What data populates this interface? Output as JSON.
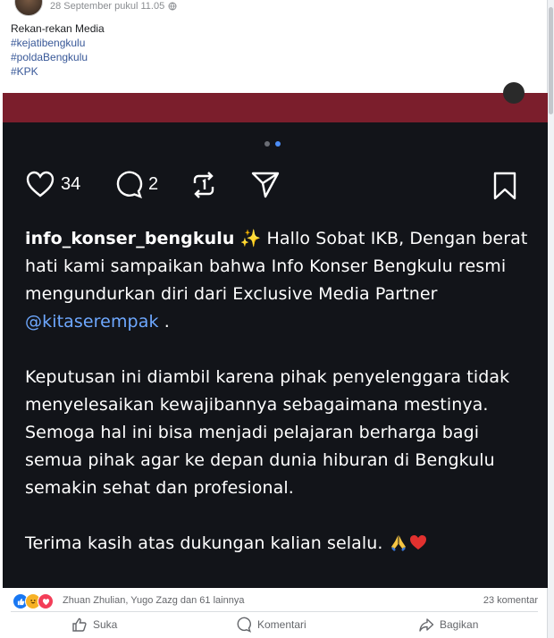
{
  "post": {
    "timestamp": "28 September pukul 11.05",
    "text_line": "Rekan-rekan Media",
    "hashtags": [
      "#kejatibengkulu",
      "#poldaBengkulu",
      "#KPK"
    ]
  },
  "instagram": {
    "likes": "34",
    "comments": "2",
    "caption": {
      "username": "info_konser_bengkulu",
      "sparkle": "✨",
      "intro": " Hallo Sobat IKB, Dengan berat hati kami sampaikan bahwa Info Konser Bengkulu resmi mengundurkan diri dari Exclusive Media Partner ",
      "mention": "@kitaserempak",
      "intro_end": " .",
      "paragraph2": "Keputusan ini diambil karena pihak penyelenggara tidak menyelesaikan kewajibannya sebagaimana mestinya. Semoga hal ini bisa menjadi pelajaran berharga bagi semua pihak agar ke depan dunia hiburan di Bengkulu semakin sehat dan profesional.",
      "paragraph3": "Terima kasih atas dukungan kalian selalu. "
    }
  },
  "reactions": {
    "names": "Zhuan Zhulian, Yugo Zazg dan 61 lainnya",
    "comments": "23 komentar"
  },
  "actions": {
    "like": "Suka",
    "comment": "Komentari",
    "share": "Bagikan"
  },
  "colors": {
    "media_bg": "#121419",
    "band": "#7b1e2c",
    "hashtag": "#385898",
    "mention": "#6ea8ff"
  }
}
